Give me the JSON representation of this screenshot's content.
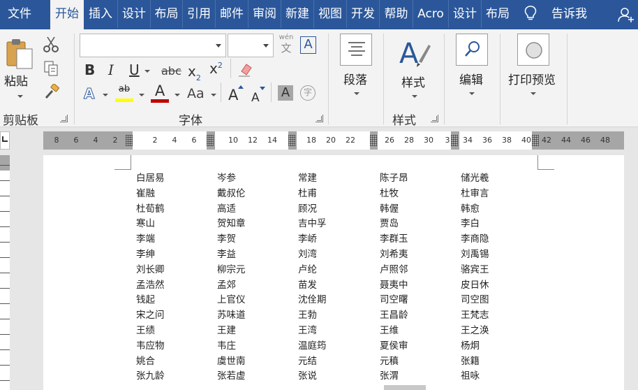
{
  "tabs": [
    {
      "label": "文件",
      "active": false
    },
    {
      "label": "开始",
      "active": true
    },
    {
      "label": "插入",
      "active": false
    },
    {
      "label": "设计",
      "active": false
    },
    {
      "label": "布局",
      "active": false
    },
    {
      "label": "引用",
      "active": false
    },
    {
      "label": "邮件",
      "active": false
    },
    {
      "label": "审阅",
      "active": false
    },
    {
      "label": "新建",
      "active": false
    },
    {
      "label": "视图",
      "active": false
    },
    {
      "label": "开发",
      "active": false
    },
    {
      "label": "帮助",
      "active": false
    },
    {
      "label": "Acro",
      "active": false
    },
    {
      "label": "设计",
      "active": false
    },
    {
      "label": "布局",
      "active": false
    }
  ],
  "tell_me": "告诉我",
  "clipboard": {
    "paste_label": "粘贴",
    "group_label": "剪贴板"
  },
  "font": {
    "group_label": "字体",
    "font_name": "",
    "font_size": "",
    "phonetic_top": "wén",
    "phonetic_bottom": "文",
    "char_border": "A",
    "bold": "B",
    "italic": "I",
    "underline": "U",
    "strikethrough": "abc",
    "subscript_base": "x",
    "subscript_sub": "2",
    "superscript_base": "x",
    "superscript_sup": "2",
    "text_effects": "A",
    "highlight": "ab",
    "font_color": "A",
    "change_case": "Aa",
    "grow_font": "A",
    "shrink_font": "A",
    "char_shading": "A",
    "enclose_char": "字"
  },
  "paragraph": {
    "label": "段落"
  },
  "styles": {
    "label": "样式",
    "group_label": "样式"
  },
  "editing": {
    "label": "编辑"
  },
  "print_preview": {
    "label": "打印预览"
  },
  "ruler": {
    "ticks": [
      "8",
      "6",
      "4",
      "2",
      "2",
      "4",
      "6",
      "10",
      "12",
      "14",
      "18",
      "20",
      "22",
      "26",
      "28",
      "30",
      "3",
      "34",
      "36",
      "38",
      "40",
      "42",
      "44",
      "46",
      "48"
    ]
  },
  "names": [
    [
      "白居易",
      "岑参",
      "常建",
      "陈子昂",
      "储光羲"
    ],
    [
      "崔融",
      "戴叔伦",
      "杜甫",
      "杜牧",
      "杜审言"
    ],
    [
      "杜荀鹤",
      "高适",
      "顾况",
      "韩偓",
      "韩愈"
    ],
    [
      "寒山",
      "贺知章",
      "吉中孚",
      "贾岛",
      "李白"
    ],
    [
      "李端",
      "李贺",
      "李峤",
      "李群玉",
      "李商隐"
    ],
    [
      "李绅",
      "李益",
      "刘湾",
      "刘希夷",
      "刘禹锡"
    ],
    [
      "刘长卿",
      "柳宗元",
      "卢纶",
      "卢照邻",
      "骆宾王"
    ],
    [
      "孟浩然",
      "孟郊",
      "苗发",
      "聂夷中",
      "皮日休"
    ],
    [
      "钱起",
      "上官仪",
      "沈佺期",
      "司空曙",
      "司空图"
    ],
    [
      "宋之问",
      "苏味道",
      "王勃",
      "王昌龄",
      "王梵志"
    ],
    [
      "王绩",
      "王建",
      "王湾",
      "王维",
      "王之涣"
    ],
    [
      "韦应物",
      "韦庄",
      "温庭筠",
      "夏侯审",
      "杨炯"
    ],
    [
      "姚合",
      "虞世南",
      "元结",
      "元稹",
      "张籍"
    ],
    [
      "张九龄",
      "张若虚",
      "张说",
      "张渭",
      "祖咏"
    ]
  ],
  "colors": {
    "title_bar": "#2b579a",
    "ribbon": "#f3f3f3",
    "highlight_bar": "#ffff00",
    "font_color_bar": "#c00000"
  }
}
